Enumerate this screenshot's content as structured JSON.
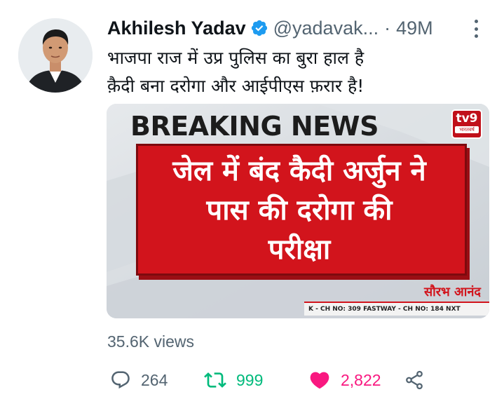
{
  "author": {
    "name": "Akhilesh Yadav",
    "handle": "@yadavak...",
    "separator": "·",
    "time": "49M"
  },
  "tweet": {
    "lines": [
      "भाजपा राज में उप्र पुलिस का बुरा हाल है",
      "क़ैदी बना दरोगा और आईपीएस फ़रार है!"
    ]
  },
  "media": {
    "headline": "BREAKING NEWS",
    "channel_logo": "tv9",
    "channel_sub": "भारतवर्ष",
    "panel_lines": [
      "जेल में बंद कैदी अर्जुन ने",
      "पास की दरोगा की",
      "परीक्षा"
    ],
    "reporter": "सौरभ आनंद",
    "ticker": "K - CH NO: 309  FASTWAY - CH NO: 184  NXT"
  },
  "views": "35.6K views",
  "actions": {
    "reply_count": "264",
    "retweet_count": "999",
    "like_count": "2,822"
  },
  "icons": {
    "verified": "verified-badge-icon",
    "more": "more-options-icon",
    "reply": "reply-icon",
    "retweet": "retweet-icon",
    "like": "heart-icon",
    "share": "share-icon"
  },
  "colors": {
    "verified": "#1d9bf0",
    "retweet": "#00ba7c",
    "like": "#f91880",
    "muted": "#536471",
    "news_red": "#d2141c"
  }
}
